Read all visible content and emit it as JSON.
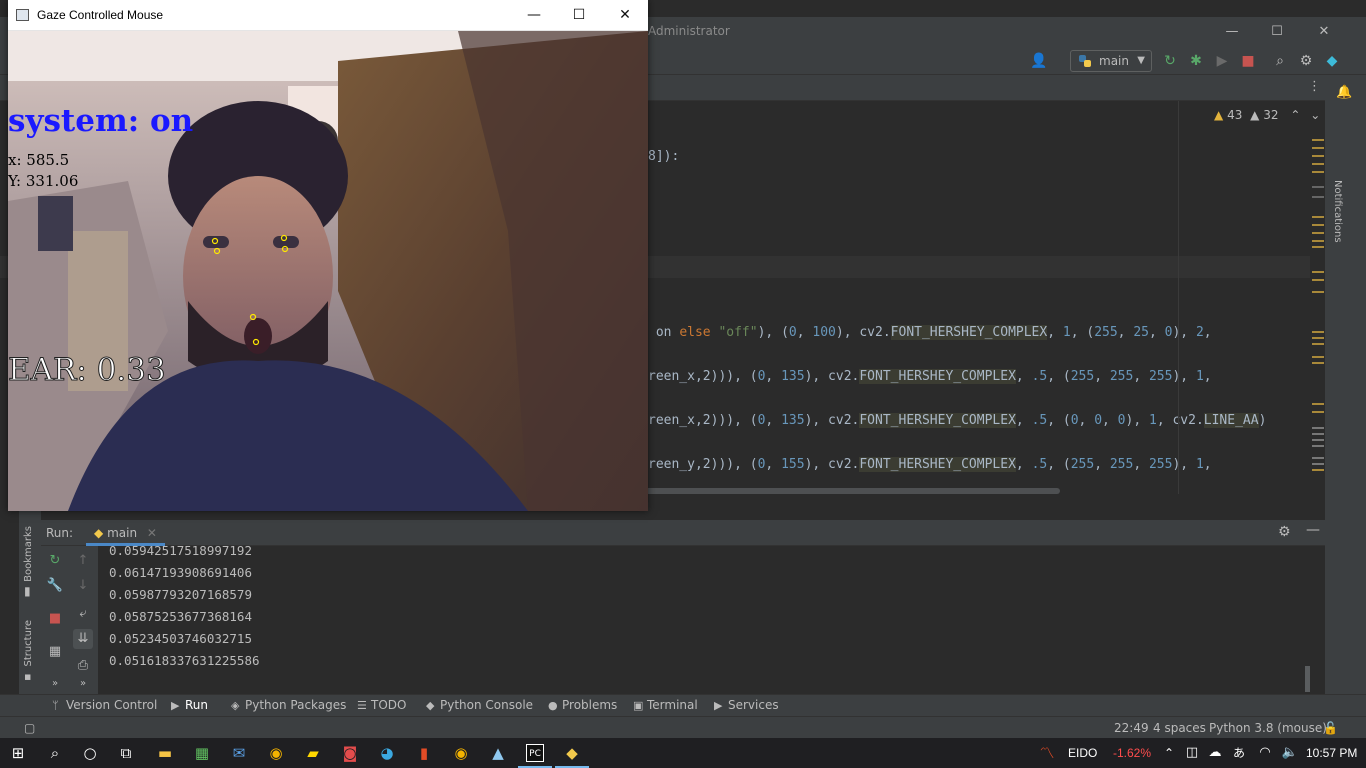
{
  "ide": {
    "title_fragment": "Administrator",
    "run_config": "main",
    "warnings": {
      "warn_count": "43",
      "weak_count": "32"
    },
    "code_lines": [
      {
        "text_a": "8]):"
      },
      {
        "p1": " on ",
        "kw1": "else",
        "p2": " ",
        "s1": "\"off\"",
        "p3": "), (",
        "n1": "0",
        "p4": ", ",
        "n2": "100",
        "p5": "), cv2.",
        "c1": "FONT_HERSHEY_COMPLEX",
        "p6": ", ",
        "n3": "1",
        "p7": ", (",
        "n4": "255",
        "p8": ", ",
        "n5": "25",
        "p9": ", ",
        "n6": "0",
        "p10": "), ",
        "n7": "2",
        "p11": ","
      },
      {
        "p1": "reen_x",
        "p2": "2))), (",
        "n1": "0",
        "p3": ", ",
        "n2": "135",
        "p4": "), cv2.",
        "c1": "FONT_HERSHEY_COMPLEX",
        "p5": ", ",
        "n3": ".5",
        "p6": ", (",
        "n4": "255",
        "p7": ", ",
        "n5": "255",
        "p8": ", ",
        "n6": "255",
        "p9": "), ",
        "n7": "1",
        "p10": ","
      },
      {
        "p1": "reen_x",
        "p2": "2))), (",
        "n1": "0",
        "p3": ", ",
        "n2": "135",
        "p4": "), cv2.",
        "c1": "FONT_HERSHEY_COMPLEX",
        "p5": ", ",
        "n3": ".5",
        "p6": ", (",
        "n4": "0",
        "p7": ", ",
        "n5": "0",
        "p8": ", ",
        "n6": "0",
        "p9": "), ",
        "n7": "1",
        "p10": ", cv2.",
        "c2": "LINE_AA",
        "p11": ")"
      },
      {
        "p1": "reen_y",
        "p2": "2))), (",
        "n1": "0",
        "p3": ", ",
        "n2": "155",
        "p4": "), cv2.",
        "c1": "FONT_HERSHEY_COMPLEX",
        "p5": ", ",
        "n3": ".5",
        "p6": ", (",
        "n4": "255",
        "p7": ", ",
        "n5": "255",
        "p8": ", ",
        "n6": "255",
        "p9": "), ",
        "n7": "1",
        "p10": ","
      }
    ],
    "notifications_label": "Notifications",
    "left_strip": {
      "bookmarks": "Bookmarks",
      "structure": "Structure"
    },
    "run_panel": {
      "label": "Run:",
      "tab": "main",
      "output": [
        "0.05942517518997192",
        "0.06147193908691406",
        "0.05987793207168579",
        "0.05875253677368164",
        "0.05234503746032715",
        "0.051618337631225586"
      ]
    },
    "bottom_tabs": [
      "Version Control",
      "Run",
      "Python Packages",
      "TODO",
      "Python Console",
      "Problems",
      "Terminal",
      "Services"
    ],
    "status": {
      "position": "22:49",
      "indent": "4 spaces",
      "interpreter": "Python 3.8 (mouse)"
    }
  },
  "cam_window": {
    "title": "Gaze Controlled Mouse",
    "system_text": "system: on",
    "x_text": "x: 585.5",
    "y_text": "Y: 331.06",
    "ear_text": "EAR: 0.33"
  },
  "taskbar": {
    "ticker": "EIDO",
    "change": "-1.62%",
    "time": "10:57 PM"
  },
  "colors": {
    "accent": "#4a88c7",
    "cam_text_blue": "#1a19ff",
    "ticker_red": "#ff4d4d"
  }
}
